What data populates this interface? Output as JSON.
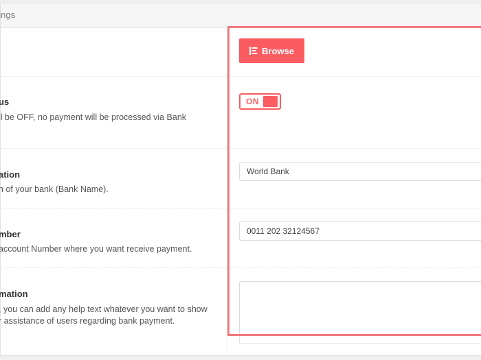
{
  "header": {
    "title": "ttings"
  },
  "rows": [
    {
      "title": "",
      "description": []
    },
    {
      "title": "us",
      "description": [
        "ll be OFF, no payment will be processed via Bank"
      ]
    },
    {
      "title": "ation",
      "description": [
        "n of your bank (Bank Name)."
      ]
    },
    {
      "title": "mber",
      "description": [
        "account Number where you want receive payment."
      ]
    },
    {
      "title": "mation",
      "description": [
        ", you can add any help text whatever you want to show",
        "r assistance of users regarding bank payment."
      ]
    }
  ],
  "controls": {
    "browse_label": "Browse",
    "toggle_label": "ON",
    "bank_name_value": "World Bank",
    "account_number_value": "0011 202 32124567",
    "instructions_value": ""
  },
  "colors": {
    "accent": "#fb5c61",
    "highlight": "#f07a80"
  },
  "icons": {
    "browse": "list-icon"
  }
}
